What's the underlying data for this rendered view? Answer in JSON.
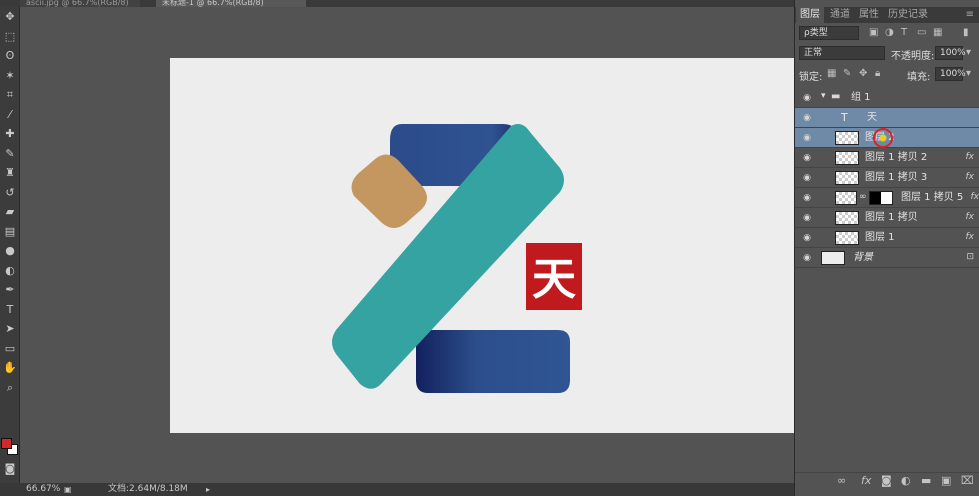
{
  "document_tabs": [
    "ascii.jpg @ 66.7%(RGB/8)",
    "未标题-1 @ 66.7%(RGB/8)"
  ],
  "tools": [
    "move-tool",
    "marquee-tool",
    "lasso-tool",
    "magic-wand-tool",
    "crop-tool",
    "eyedropper-tool",
    "healing-brush-tool",
    "brush-tool",
    "clone-stamp-tool",
    "history-brush-tool",
    "eraser-tool",
    "gradient-tool",
    "blur-tool",
    "dodge-tool",
    "pen-tool",
    "type-tool",
    "path-selection-tool",
    "shape-tool",
    "hand-tool",
    "zoom-tool"
  ],
  "colors": {
    "foreground": "#d12a2a",
    "background": "#ffffff",
    "selection": "#6f8aa6",
    "canvas": "#ecedec"
  },
  "logo": {
    "character": "天",
    "colors": {
      "tan": "#c49660",
      "teal": "#36a3a3",
      "navy": "#2f4f8a",
      "red": "#c11a1e"
    }
  },
  "status": {
    "zoom": "66.67%",
    "document": "文档:2.64M/8.18M"
  },
  "panel": {
    "tabs": [
      "图层",
      "通道",
      "属性",
      "历史记录"
    ],
    "filter_kind": "ρ类型",
    "blend_mode": "正常",
    "opacity_label": "不透明度:",
    "opacity_value": "100%",
    "lock_label": "锁定:",
    "fill_label": "填充:",
    "fill_value": "100%",
    "layers": [
      {
        "name": "组 1",
        "type": "group"
      },
      {
        "name": "天",
        "type": "text"
      },
      {
        "name": "图层 2",
        "type": "pixel"
      },
      {
        "name": "图层 1 拷贝 2",
        "type": "pixel",
        "fx": "fx"
      },
      {
        "name": "图层 1 拷贝 3",
        "type": "pixel",
        "fx": "fx"
      },
      {
        "name": "图层 1 拷贝 5",
        "type": "masked",
        "fx": "fx"
      },
      {
        "name": "图层 1 拷贝",
        "type": "pixel",
        "fx": "fx"
      },
      {
        "name": "图层 1",
        "type": "pixel",
        "fx": "fx"
      },
      {
        "name": "背景",
        "type": "background"
      }
    ]
  }
}
